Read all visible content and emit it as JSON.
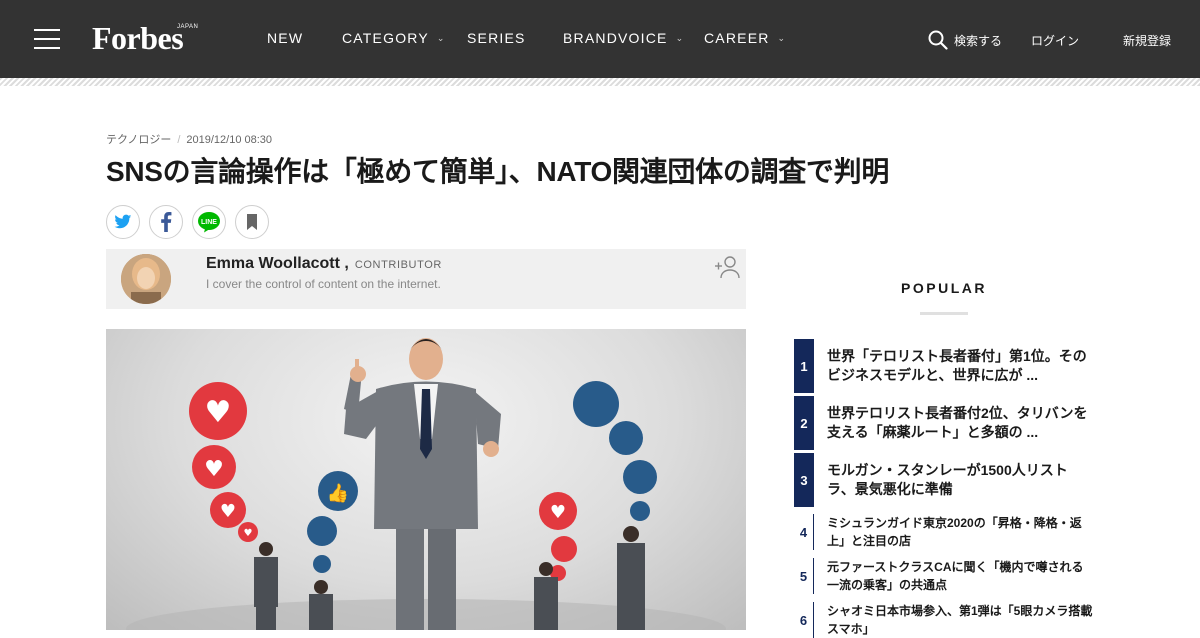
{
  "header": {
    "logo": "Forbes",
    "logo_sub": "JAPAN",
    "nav": [
      {
        "label": "NEW",
        "has_dropdown": false
      },
      {
        "label": "CATEGORY",
        "has_dropdown": true
      },
      {
        "label": "SERIES",
        "has_dropdown": false
      },
      {
        "label": "BRANDVOICE",
        "has_dropdown": true
      },
      {
        "label": "CAREER",
        "has_dropdown": true
      }
    ],
    "search_label": "検索する",
    "login_label": "ログイン",
    "signup_label": "新規登録",
    "background_color": "#333333"
  },
  "article": {
    "category": "テクノロジー",
    "separator": "/",
    "date": "2019/12/10 08:30",
    "title": "SNSの言論操作は「極めて簡単」、NATO関連団体の調査で判明",
    "share_icons": [
      "twitter-icon",
      "facebook-icon",
      "line-icon",
      "bookmark-icon"
    ],
    "author": {
      "name": "Emma Woollacott ,",
      "role": "CONTRIBUTOR",
      "description": "I cover the control of content on the internet."
    }
  },
  "sidebar": {
    "heading": "POPULAR",
    "accent_color": "#14285a",
    "items": [
      {
        "rank": "1",
        "line1": "世界「テロリスト長者番付」第1位。その",
        "line2": "ビジネスモデルと、世界に広が ..."
      },
      {
        "rank": "2",
        "line1": "世界テロリスト長者番付2位、タリバンを",
        "line2": "支える「麻薬ルート」と多額の ..."
      },
      {
        "rank": "3",
        "line1": "モルガン・スタンレーが1500人リスト",
        "line2": "ラ、景気悪化に準備"
      },
      {
        "rank": "4",
        "line1": "ミシュランガイド東京2020の「昇格・降格・返",
        "line2": "上」と注目の店"
      },
      {
        "rank": "5",
        "line1": "元ファーストクラスCAに聞く「機内で噂される",
        "line2": "一流の乗客」の共通点"
      },
      {
        "rank": "6",
        "line1": "シャオミ日本市場参入、第1弾は「5眼カメラ搭載",
        "line2": "スマホ」"
      }
    ]
  }
}
